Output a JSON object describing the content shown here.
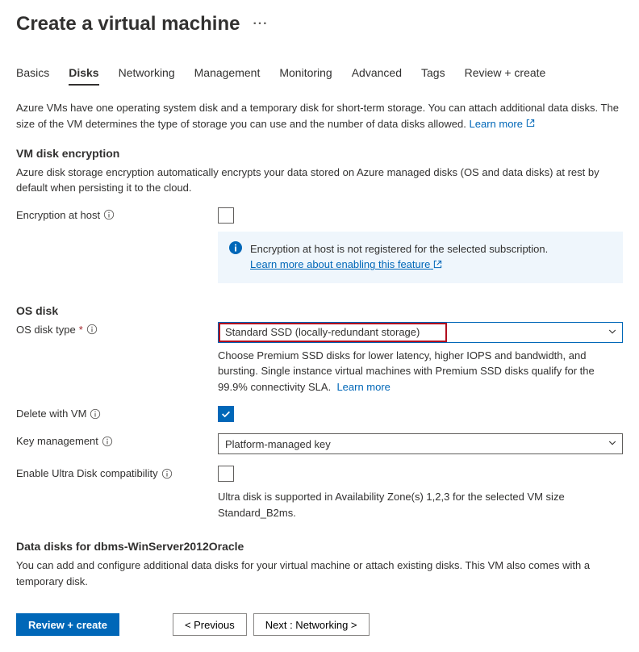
{
  "page_title": "Create a virtual machine",
  "tabs": [
    "Basics",
    "Disks",
    "Networking",
    "Management",
    "Monitoring",
    "Advanced",
    "Tags",
    "Review + create"
  ],
  "active_tab": "Disks",
  "intro_text": "Azure VMs have one operating system disk and a temporary disk for short-term storage. You can attach additional data disks. The size of the VM determines the type of storage you can use and the number of data disks allowed.",
  "intro_learn_more": "Learn more",
  "encryption": {
    "heading": "VM disk encryption",
    "desc": "Azure disk storage encryption automatically encrypts your data stored on Azure managed disks (OS and data disks) at rest by default when persisting it to the cloud.",
    "host_label": "Encryption at host",
    "host_checked": false,
    "info_text": "Encryption at host is not registered for the selected subscription.",
    "info_link": "Learn more about enabling this feature"
  },
  "os_disk": {
    "heading": "OS disk",
    "type_label": "OS disk type",
    "type_value": "Standard SSD (locally-redundant storage)",
    "type_helper": "Choose Premium SSD disks for lower latency, higher IOPS and bandwidth, and bursting. Single instance virtual machines with Premium SSD disks qualify for the 99.9% connectivity SLA.",
    "type_learn_more": "Learn more",
    "delete_label": "Delete with VM",
    "delete_checked": true,
    "key_label": "Key management",
    "key_value": "Platform-managed key",
    "ultra_label": "Enable Ultra Disk compatibility",
    "ultra_checked": false,
    "ultra_helper": "Ultra disk is supported in Availability Zone(s) 1,2,3 for the selected VM size Standard_B2ms."
  },
  "data_disks": {
    "heading": "Data disks for dbms-WinServer2012Oracle",
    "desc": "You can add and configure additional data disks for your virtual machine or attach existing disks. This VM also comes with a temporary disk."
  },
  "footer": {
    "review": "Review + create",
    "previous": "< Previous",
    "next": "Next : Networking >"
  }
}
